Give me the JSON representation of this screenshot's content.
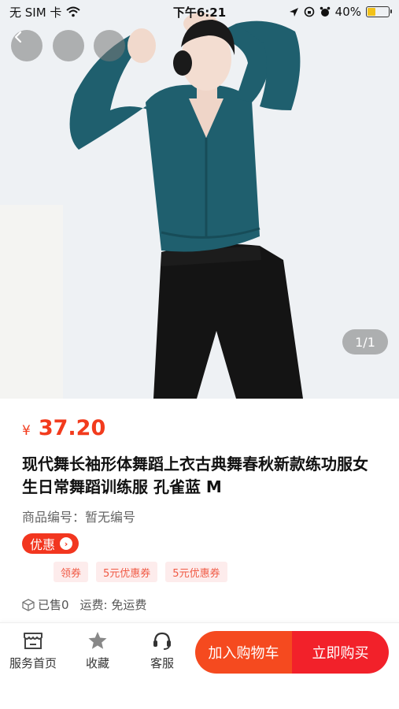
{
  "status_bar": {
    "carrier": "无 SIM 卡",
    "time": "下午6:21",
    "battery_percent": "40%",
    "battery_level": 0.4,
    "icons": [
      "wifi-icon",
      "location-icon",
      "lock-rotation-icon",
      "alarm-icon",
      "battery-icon"
    ]
  },
  "header": {
    "back_icon": "chevron-left-icon",
    "page_indicator": "1/1"
  },
  "product": {
    "currency": "¥",
    "price": "37.20",
    "title": "现代舞长袖形体舞蹈上衣古典舞春秋新款练功服女生日常舞蹈训练服 孔雀蓝 M",
    "sku": "商品编号：暂无编号",
    "promo_label": "优惠",
    "coupons": [
      "领券",
      "5元优惠券",
      "5元优惠券"
    ],
    "sold": "已售0",
    "shipping": "运费: 免运费"
  },
  "bottom_bar": {
    "home_label": "服务首页",
    "favorite_label": "收藏",
    "service_label": "客服",
    "add_to_cart": "加入购物车",
    "buy_now": "立即购买"
  },
  "colors": {
    "price": "#f23b1d",
    "cart_button": "#f54a1f",
    "buy_button": "#f2212a",
    "coupon_bg": "#fdecec"
  }
}
